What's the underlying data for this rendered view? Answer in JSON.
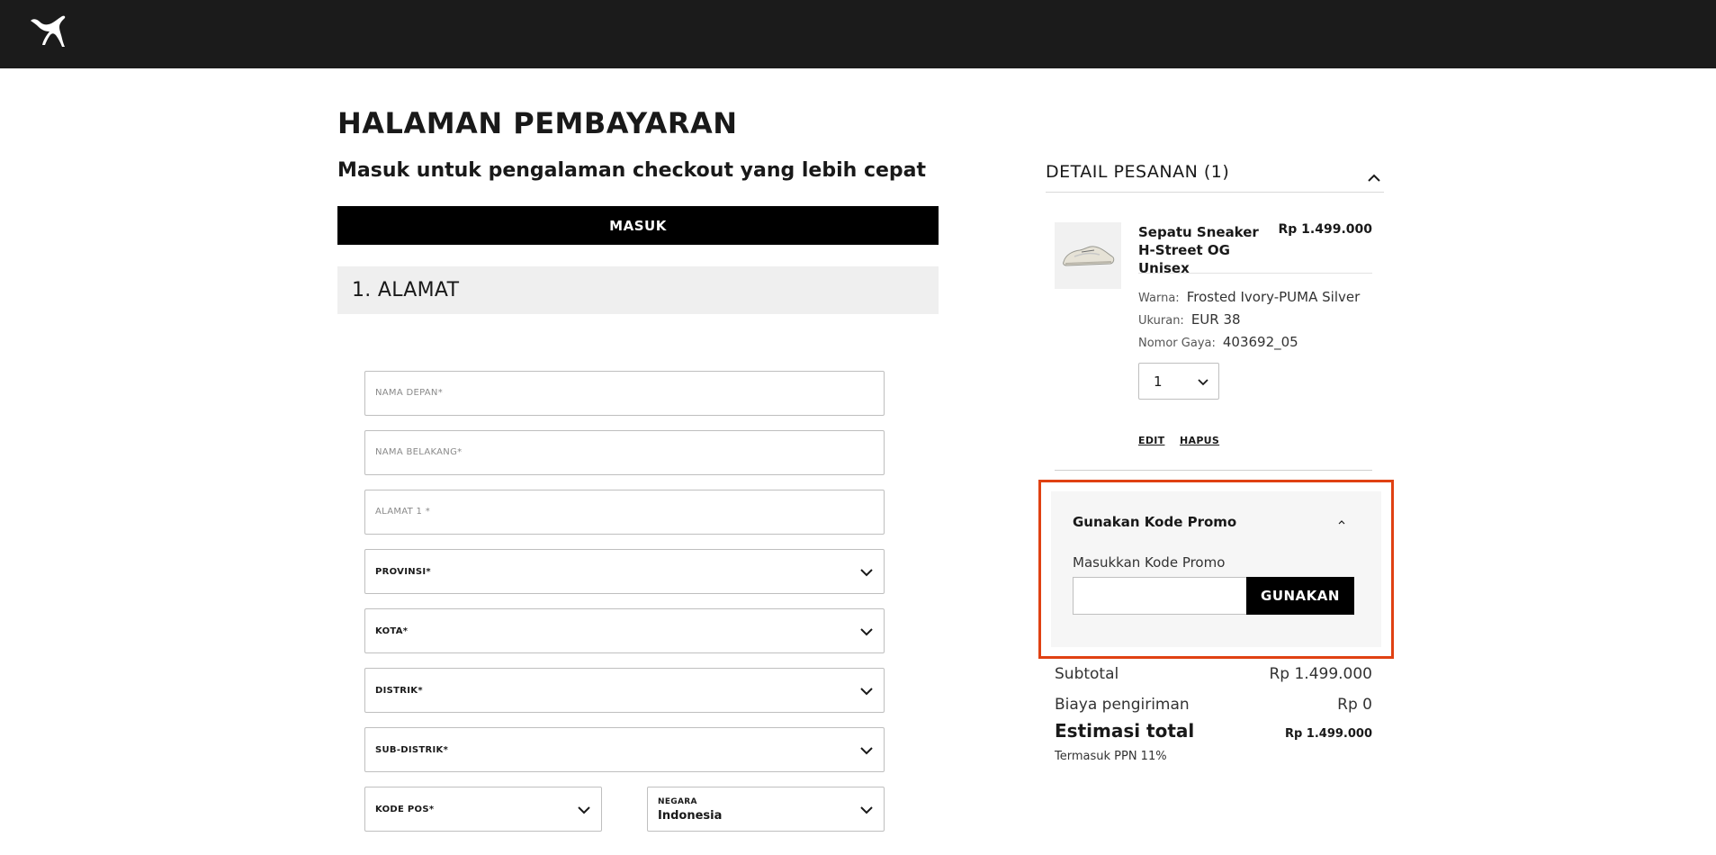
{
  "header": {
    "logo_icon": "puma-logo-icon"
  },
  "checkout": {
    "title": "HALAMAN PEMBAYARAN",
    "login_prompt": "Masuk untuk pengalaman checkout yang lebih cepat",
    "login_button": "MASUK"
  },
  "address": {
    "section_title": "1. ALAMAT",
    "first_name_placeholder": "NAMA DEPAN*",
    "last_name_placeholder": "NAMA BELAKANG*",
    "address1_placeholder": "ALAMAT 1 *",
    "province_label": "PROVINSI*",
    "city_label": "KOTA*",
    "district_label": "DISTRIK*",
    "subdistrict_label": "SUB-DISTRIK*",
    "postcode_label": "KODE POS*",
    "country_label": "NEGARA",
    "country_value": "Indonesia"
  },
  "order": {
    "title": "DETAIL PESANAN (1)",
    "item": {
      "name": "Sepatu Sneaker H-Street OG Unisex",
      "price": "Rp 1.499.000",
      "color_label": "Warna:",
      "color_value": "Frosted Ivory-PUMA Silver",
      "size_label": "Ukuran:",
      "size_value": "EUR 38",
      "style_label": "Nomor Gaya:",
      "style_value": "403692_05",
      "quantity": "1",
      "edit_label": "EDIT",
      "remove_label": "HAPUS"
    }
  },
  "promo": {
    "title": "Gunakan Kode Promo",
    "input_label": "Masukkan Kode Promo",
    "input_value": "",
    "apply_button": "GUNAKAN",
    "highlight_color": "#e04112"
  },
  "summary": {
    "subtotal_label": "Subtotal",
    "subtotal_value": "Rp 1.499.000",
    "shipping_label": "Biaya pengiriman",
    "shipping_value": "Rp 0",
    "total_label": "Estimasi total",
    "total_value": "Rp 1.499.000",
    "tax_note": "Termasuk PPN 11%"
  }
}
